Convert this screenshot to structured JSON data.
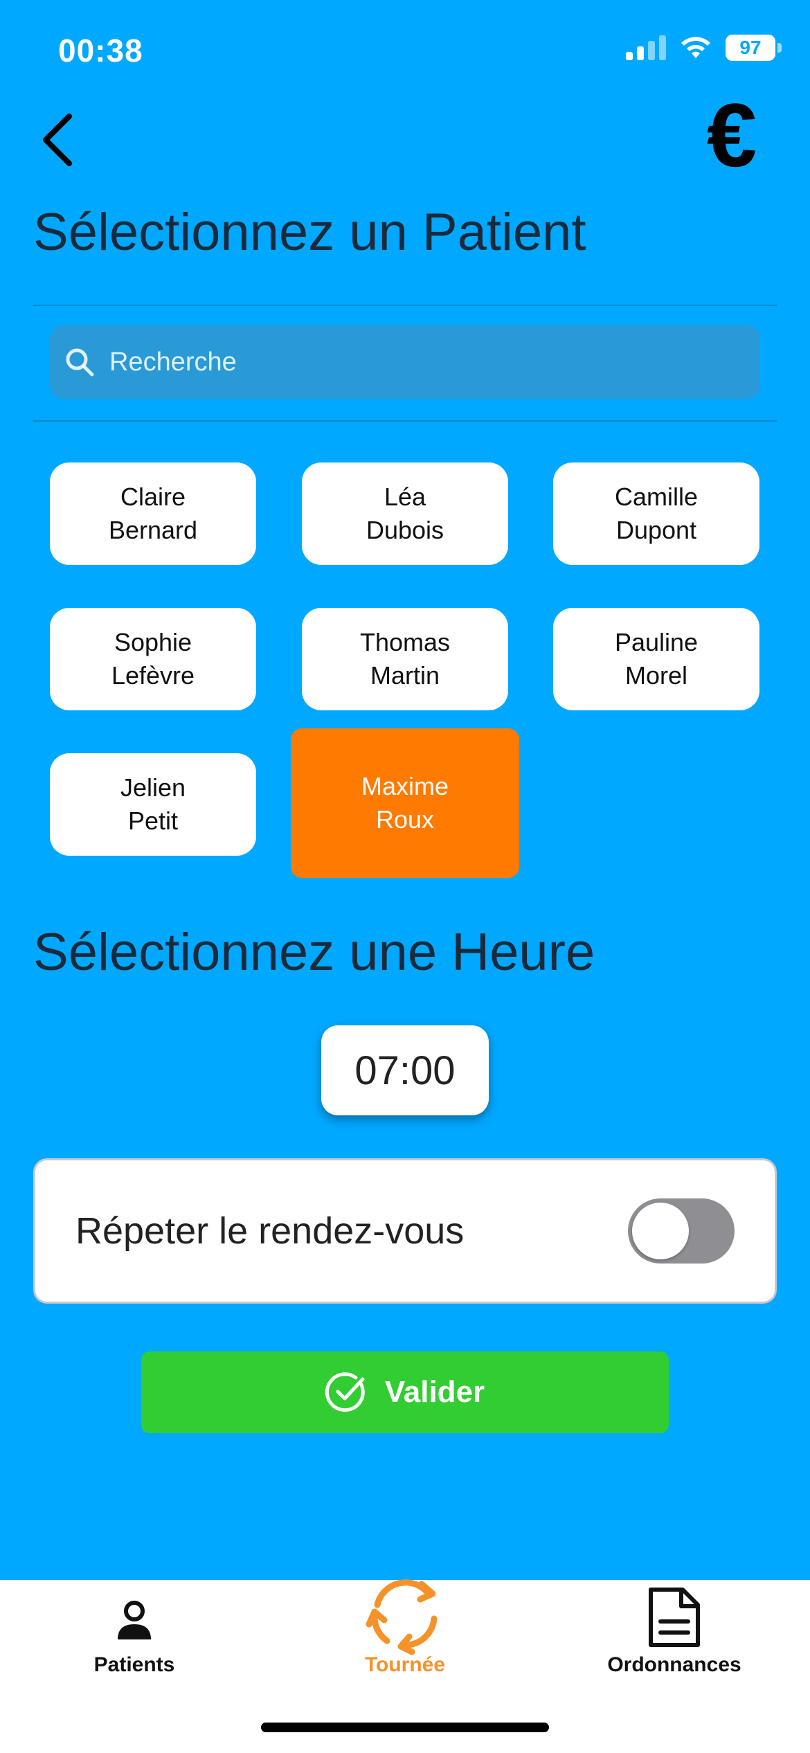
{
  "status_bar": {
    "time": "00:38",
    "battery": "97",
    "icons": [
      "signal-icon",
      "wifi-icon",
      "battery-icon"
    ]
  },
  "header": {
    "back_icon": "chevron-left-icon",
    "euro_symbol": "€"
  },
  "patient_section": {
    "title": "Sélectionnez un Patient",
    "search_placeholder": "Recherche",
    "patients": [
      {
        "name": "Claire\nBernard",
        "selected": false
      },
      {
        "name": "Léa\nDubois",
        "selected": false
      },
      {
        "name": "Camille\nDupont",
        "selected": false
      },
      {
        "name": "Sophie\nLefèvre",
        "selected": false
      },
      {
        "name": "Thomas\nMartin",
        "selected": false
      },
      {
        "name": "Pauline\nMorel",
        "selected": false
      },
      {
        "name": "Jelien\nPetit",
        "selected": false
      },
      {
        "name": "Maxime\nRoux",
        "selected": true
      }
    ]
  },
  "time_section": {
    "title": "Sélectionnez une Heure",
    "time": "07:00"
  },
  "repeat": {
    "label": "Répeter le rendez-vous",
    "enabled": false
  },
  "validate": {
    "label": "Valider",
    "icon": "check-circle-icon"
  },
  "tab_bar": {
    "tabs": [
      {
        "label": "Patients",
        "icon": "person-icon",
        "active": false
      },
      {
        "label": "Tournée",
        "icon": "refresh-cycle-icon",
        "active": true
      },
      {
        "label": "Ordonnances",
        "icon": "document-icon",
        "active": false
      }
    ]
  },
  "colors": {
    "background": "#00a8ff",
    "selected_patient": "#ff7a00",
    "validate_button": "#32cd32",
    "active_tab": "#f5922a"
  }
}
